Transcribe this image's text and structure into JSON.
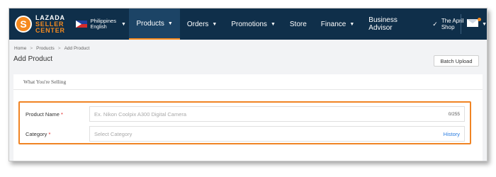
{
  "brand": {
    "line1": "LAZADA",
    "line2": "SELLER",
    "line3": "CENTER",
    "mark": "S",
    "accent": "#f58a1f",
    "nav_bg": "#0f2f4a"
  },
  "country": {
    "name": "Philippines",
    "language": "English"
  },
  "nav": {
    "items": [
      {
        "label": "Products"
      },
      {
        "label": "Orders"
      },
      {
        "label": "Promotions"
      },
      {
        "label": "Store"
      },
      {
        "label": "Finance"
      },
      {
        "label": "Business Advisor"
      }
    ],
    "shop": "The April Shop"
  },
  "breadcrumb": [
    "Home",
    "Products",
    "Add Product"
  ],
  "page": {
    "title": "Add Product",
    "batch_upload": "Batch Upload"
  },
  "section": {
    "title": "What You're Selling"
  },
  "form": {
    "product_name": {
      "label": "Product Name",
      "placeholder": "Ex. Nikon Coolpix A300 Digital Camera",
      "counter": "0/255"
    },
    "category": {
      "label": "Category",
      "placeholder": "Select Category",
      "history": "History"
    },
    "required_mark": "*"
  },
  "icons": {
    "caret": "▼",
    "check": "✓",
    "separator": ">"
  }
}
